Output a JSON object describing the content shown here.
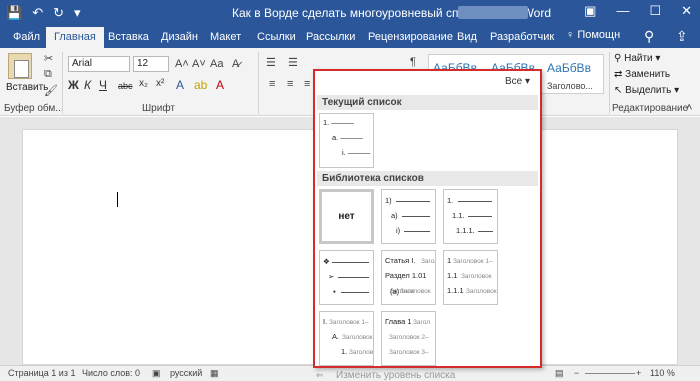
{
  "titlebar": {
    "title": "Как в Ворде сделать многоуровневый список.docx - Word",
    "save_icon": "save-icon",
    "undo_icon": "undo-icon",
    "redo_icon": "redo-icon",
    "window_controls": [
      "restore-ribbon-icon",
      "minimize-icon",
      "maximize-icon",
      "close-icon"
    ]
  },
  "tabs": {
    "items": [
      "Файл",
      "Главная",
      "Вставка",
      "Дизайн",
      "Макет",
      "Ссылки",
      "Рассылки",
      "Рецензирование",
      "Вид",
      "Разработчик"
    ],
    "active_index": 1,
    "help": "Помощн"
  },
  "ribbon": {
    "paste_label": "Вставить",
    "clipboard_label": "Буфер обм...",
    "font_label": "Шрифт",
    "font_name": "Arial",
    "font_size": "12",
    "format_buttons": [
      "Ж",
      "К",
      "Ч",
      "abc",
      "x₂",
      "x²"
    ],
    "styles_samples": [
      "АаБбВв",
      "АаБбВв",
      "АаБбВв"
    ],
    "styles_subs": [
      "",
      "",
      "Заголово..."
    ],
    "edit": {
      "find": "Найти",
      "replace": "Заменить",
      "select": "Выделить",
      "group_label": "Редактирование"
    }
  },
  "panel": {
    "filter": "Все",
    "current_header": "Текущий список",
    "library_header": "Библиотека списков",
    "none_label": "нет",
    "footer": "Изменить уровень списка",
    "current_list": [
      "1. ———",
      "a. ———",
      "i. ———"
    ],
    "lib": {
      "t2": [
        "1)",
        "a)",
        "i)"
      ],
      "t3": [
        "1.",
        "1.1.",
        "1.1.1."
      ],
      "t4": [
        "❖",
        "➢",
        "▪"
      ],
      "t5": [
        "Статья I.",
        "Заголов",
        "Раздел 1.01",
        "Заголов",
        "(a)",
        "Заголовок"
      ],
      "t6": [
        "1",
        "Заголовок 1–",
        "1.1",
        "Заголовок",
        "1.1.1",
        "Заголовок"
      ],
      "t7": [
        "I.",
        "Заголовок 1–",
        "A.",
        "Заголовок",
        "1.",
        "Заголово"
      ],
      "t8": [
        "Глава 1",
        "Загол",
        "Заголовок 2–",
        "Заголовок 3–"
      ]
    }
  },
  "statusbar": {
    "page": "Страница 1 из 1",
    "words": "Число слов: 0",
    "lang": "русский",
    "zoom": "110 %"
  },
  "colors": {
    "word_blue": "#2b579a",
    "highlight_red": "#d52b2b"
  }
}
